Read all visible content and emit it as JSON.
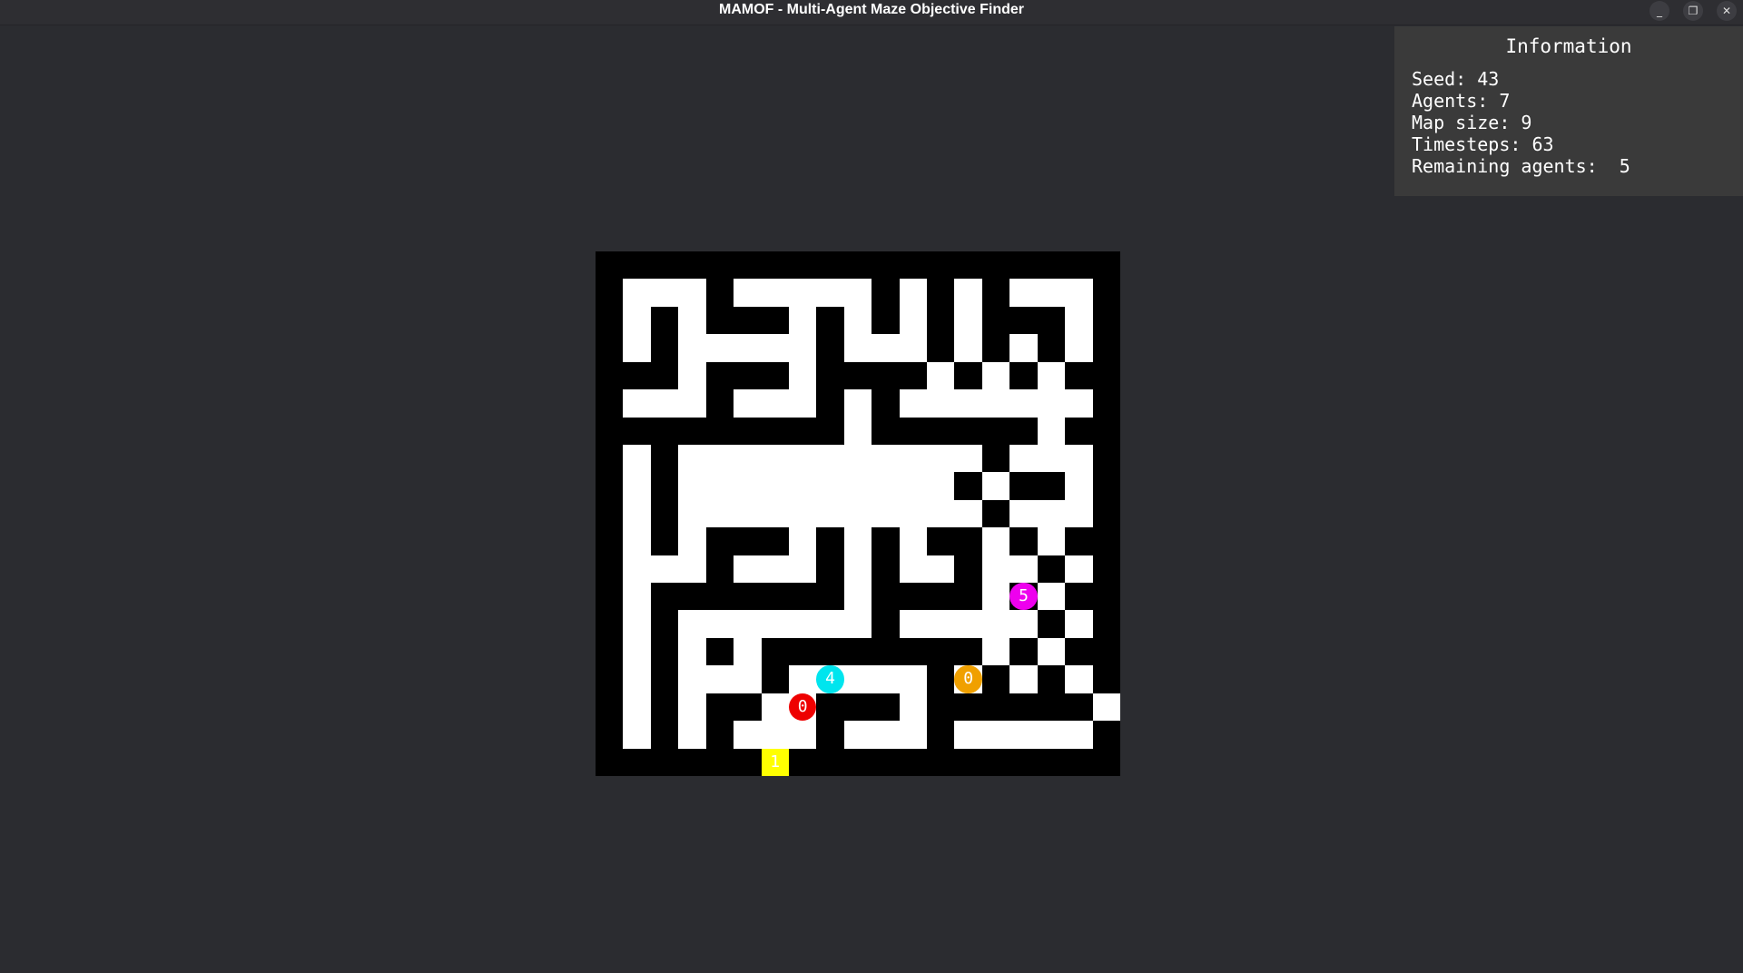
{
  "window": {
    "title": "MAMOF - Multi-Agent Maze Objective Finder",
    "controls": [
      "_",
      "❐",
      "✕"
    ]
  },
  "info": {
    "heading": "Information",
    "seed": "Seed: 43",
    "agents": "Agents: 7",
    "map_size": "Map size: 9",
    "timesteps": "Timesteps: 63",
    "remaining": "Remaining agents:  5"
  },
  "maze": {
    "size": 19,
    "wall_color": "#000000",
    "path_color": "#ffffff",
    "rows": [
      "###################",
      "#...#.....#.#.#...#",
      "#.#.###.#.#.#.###.#",
      "#.#.....#...#.#.#.#",
      "###.###.####.#.#.#",
      "#...#...#.#.......#",
      "#########.######.##",
      "#.#...........#...#",
      "#.#..........#.##.#",
      "#.#...........#...#",
      "#.#.###.#.#.##.#.#",
      "#...#...#.#..#..#.#",
      "#.#######.####.#.#",
      "#.#.......#.....#.#",
      "#.#.#.########.#.#",
      "#.#...#.....#.#.#.#",
      "#.#.##..###.######.#",
      "#.#.#...#...#.....#",
      "###################"
    ]
  },
  "agents": [
    {
      "id": "0",
      "color": "#ee0000",
      "row": 16,
      "col": 7
    },
    {
      "id": "4",
      "color": "#00e5ee",
      "row": 15,
      "col": 8
    },
    {
      "id": "0",
      "color": "#f0a000",
      "row": 15,
      "col": 13
    },
    {
      "id": "5",
      "color": "#ee00ee",
      "row": 12,
      "col": 15
    }
  ],
  "goal": {
    "id": "1",
    "color": "#ffff00",
    "row": 18,
    "col": 6
  }
}
